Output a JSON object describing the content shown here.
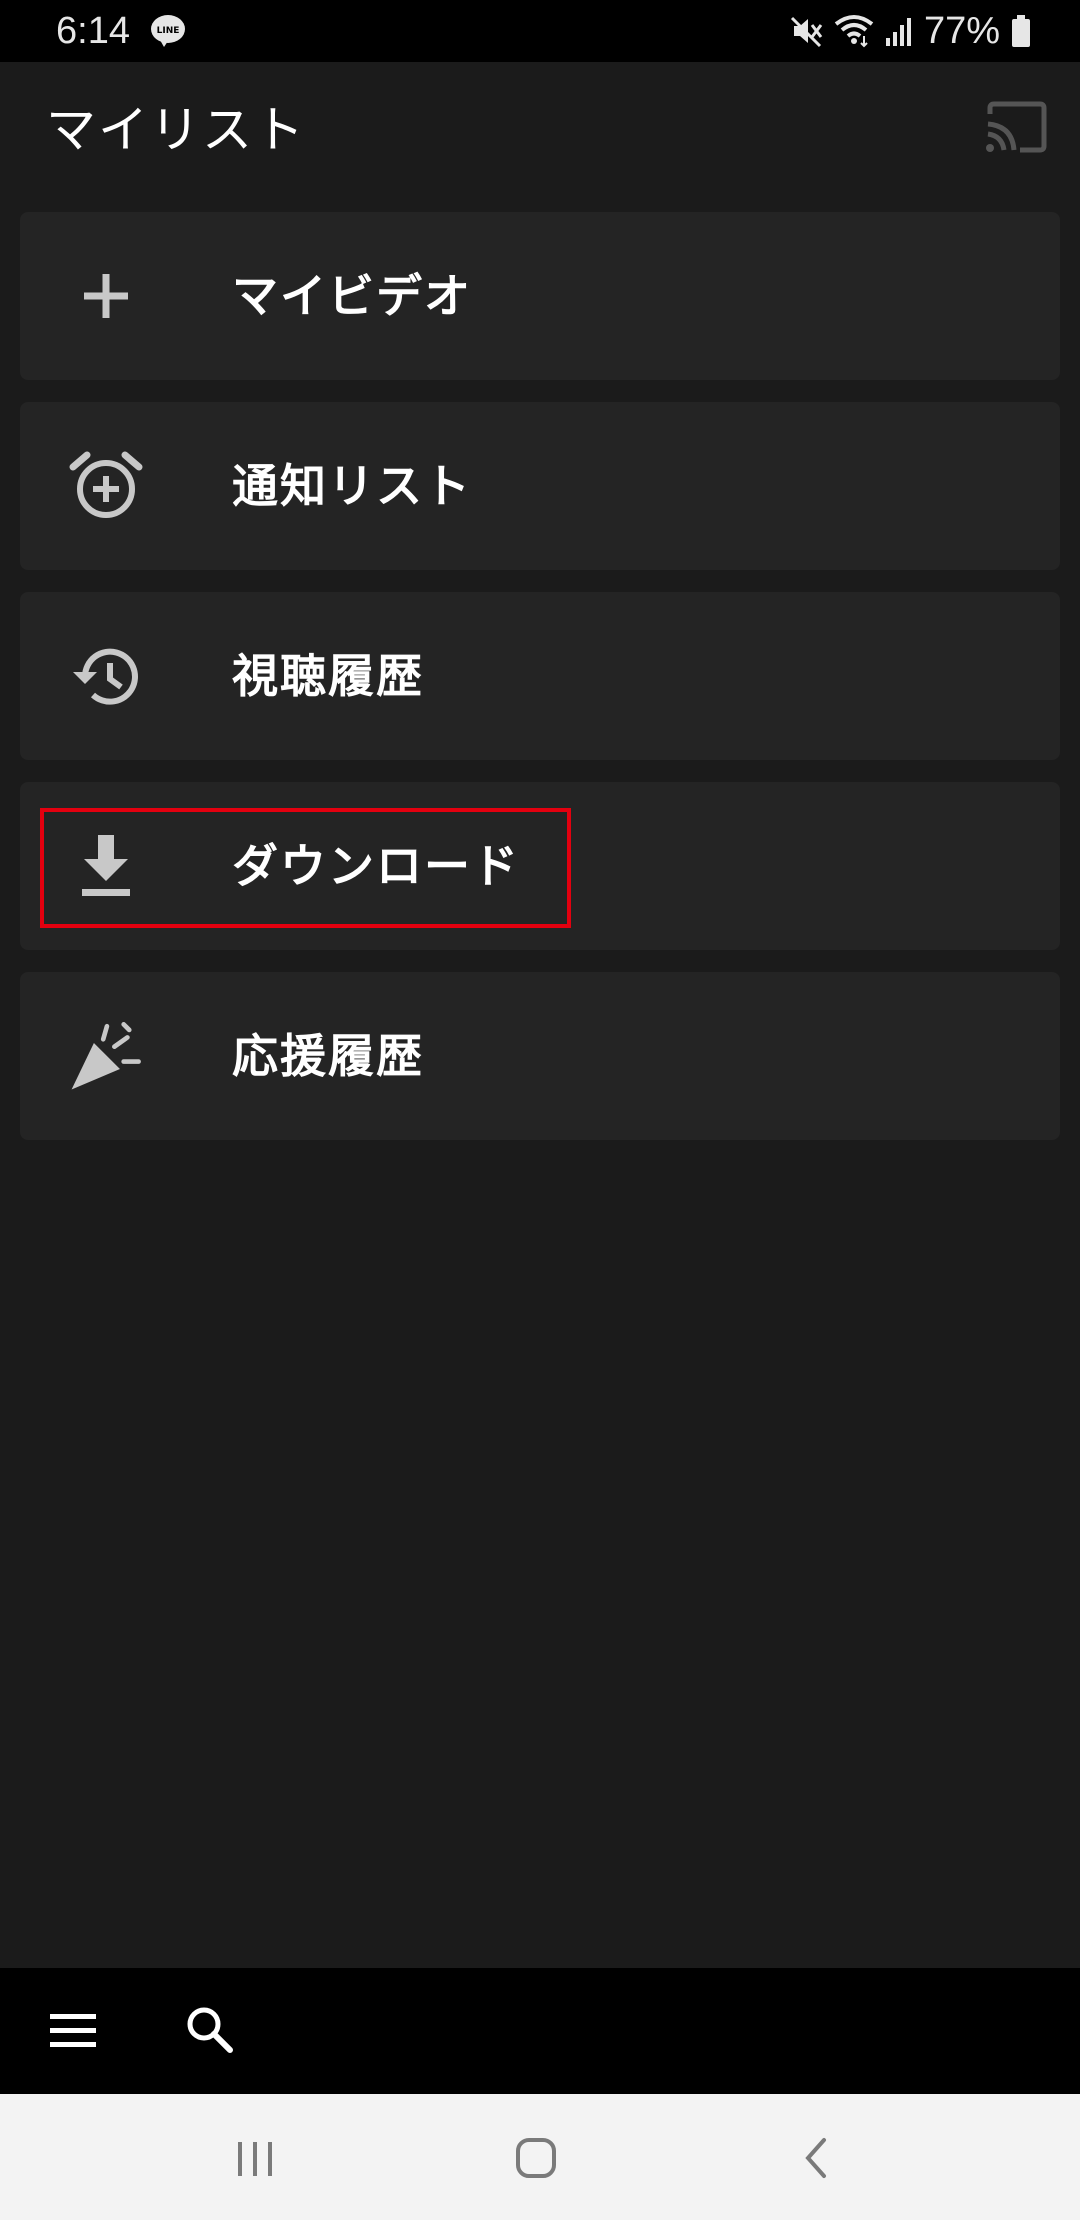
{
  "status_bar": {
    "time": "6:14",
    "notification_icon": "line-app-icon",
    "battery": "77%",
    "icons": [
      "mute-icon",
      "wifi-icon",
      "signal-icon",
      "battery-icon"
    ]
  },
  "header": {
    "title": "マイリスト",
    "cast_icon": "cast-icon"
  },
  "menu": {
    "items": [
      {
        "label": "マイビデオ",
        "icon": "plus-icon"
      },
      {
        "label": "通知リスト",
        "icon": "alarm-add-icon"
      },
      {
        "label": "視聴履歴",
        "icon": "history-icon"
      },
      {
        "label": "ダウンロード",
        "icon": "download-icon",
        "highlighted": true
      },
      {
        "label": "応援履歴",
        "icon": "party-popper-icon"
      }
    ]
  },
  "bottom_bar": {
    "icons": [
      "hamburger-menu-icon",
      "search-icon"
    ]
  },
  "nav_bar": {
    "icons": [
      "recent-apps-icon",
      "home-icon",
      "back-icon"
    ]
  },
  "colors": {
    "background": "#1b1b1b",
    "card": "#242424",
    "highlight": "#e3000f",
    "bars": "#000000",
    "nav_bar": "#f3f3f3"
  }
}
